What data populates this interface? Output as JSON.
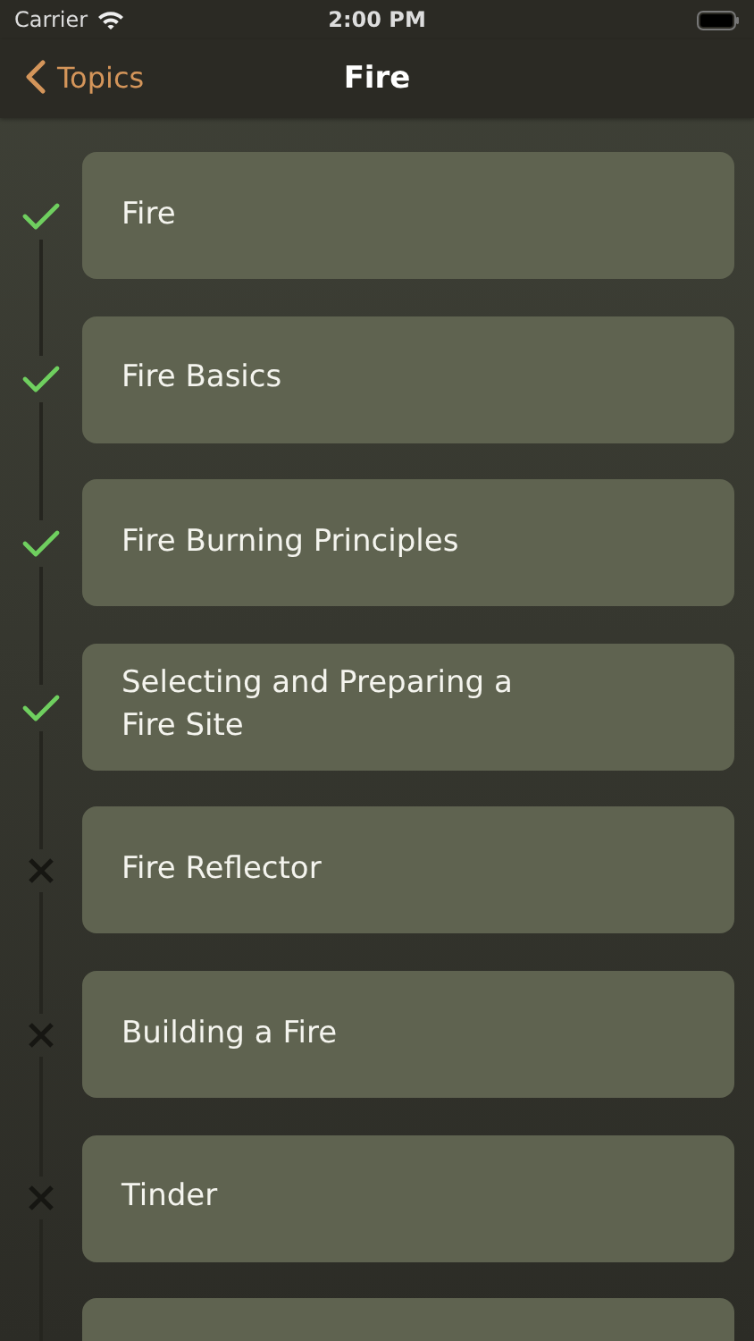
{
  "status_bar": {
    "carrier": "Carrier",
    "time": "2:00 PM"
  },
  "nav": {
    "back": "Topics",
    "title": "Fire"
  },
  "items": [
    {
      "title": "Fire",
      "completed": true
    },
    {
      "title": "Fire Basics",
      "completed": true
    },
    {
      "title": "Fire Burning Principles",
      "completed": true
    },
    {
      "title": "Selecting and Preparing a Fire Site",
      "completed": true
    },
    {
      "title": "Fire Reflector",
      "completed": false
    },
    {
      "title": "Building a Fire",
      "completed": false
    },
    {
      "title": "Tinder",
      "completed": false
    }
  ]
}
